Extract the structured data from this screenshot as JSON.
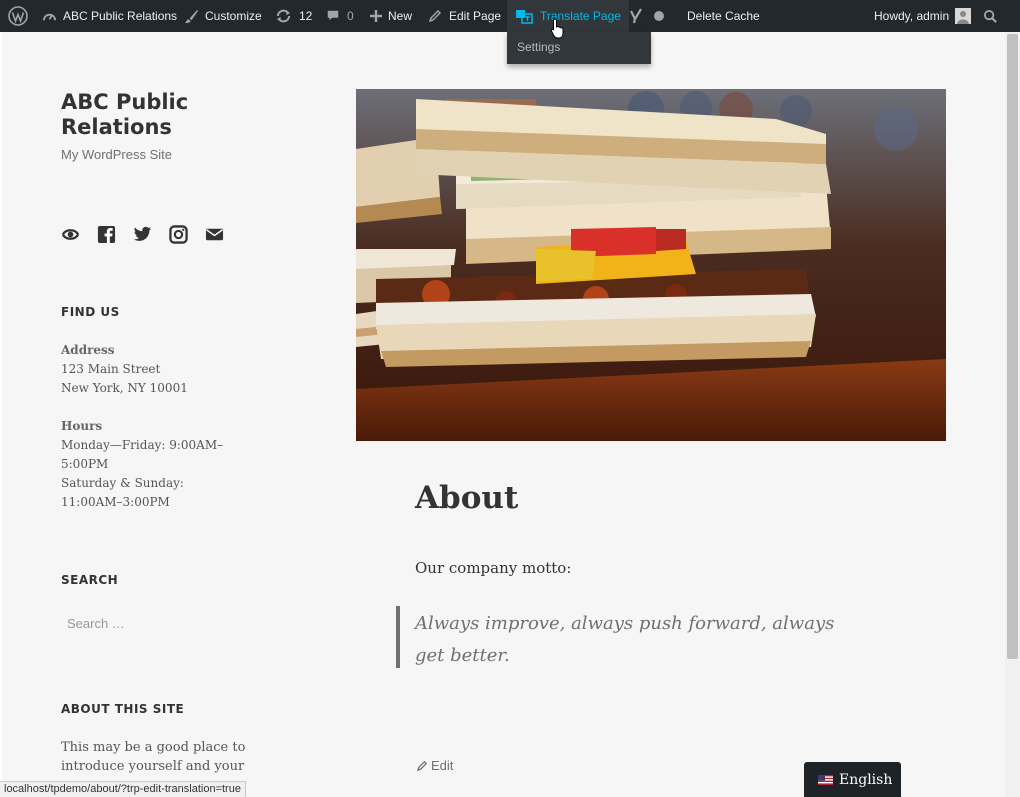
{
  "adminbar": {
    "site_name": "ABC Public Relations",
    "customize": "Customize",
    "updates_count": "12",
    "comments_count": "0",
    "new_label": "New",
    "edit_page": "Edit Page",
    "translate_page": "Translate Page",
    "delete_cache": "Delete Cache",
    "howdy": "Howdy, admin",
    "accent_color": "#00b9eb",
    "bar_color": "#23282d"
  },
  "translate_dropdown": {
    "settings": "Settings"
  },
  "site": {
    "title": "ABC Public Relations",
    "description": "My WordPress Site"
  },
  "social_icons": [
    "wordpress-icon",
    "facebook-icon",
    "twitter-icon",
    "instagram-icon",
    "email-icon"
  ],
  "find_us": {
    "title": "FIND US",
    "address_label": "Address",
    "address_line1": "123 Main Street",
    "address_line2": "New York, NY 10001",
    "hours_label": "Hours",
    "hours_line1": "Monday—Friday: 9:00AM–",
    "hours_line2": "5:00PM",
    "hours_line3": "Saturday & Sunday:",
    "hours_line4": "11:00AM–3:00PM"
  },
  "search": {
    "title": "SEARCH",
    "placeholder": "Search …"
  },
  "about_site": {
    "title": "ABOUT THIS SITE",
    "text": "This may be a good place to introduce yourself and your"
  },
  "content": {
    "title": "About",
    "motto_label": "Our company motto:",
    "quote": "Always improve, always push forward, always get better.",
    "edit": "Edit"
  },
  "language_switcher": {
    "label": "English"
  },
  "status_bar": {
    "url": "localhost/tpdemo/about/?trp-edit-translation=true"
  }
}
